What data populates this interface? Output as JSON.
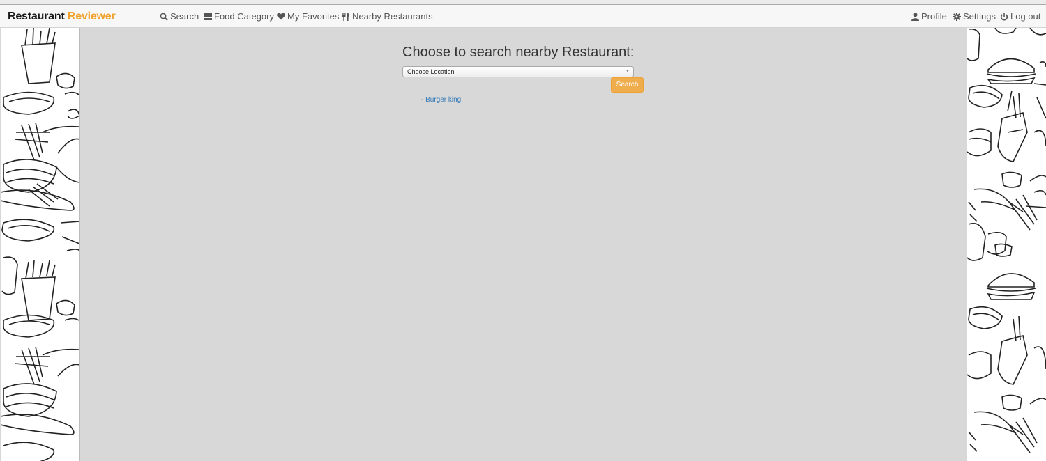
{
  "brand": {
    "name_part1": "Restaurant",
    "name_part2": "Reviewer"
  },
  "nav_left": [
    {
      "label": "Search",
      "icon": "search-icon"
    },
    {
      "label": "Food Category",
      "icon": "list-icon"
    },
    {
      "label": "My Favorites",
      "icon": "heart-icon"
    },
    {
      "label": "Nearby Restaurants",
      "icon": "cutlery-icon"
    }
  ],
  "nav_right": [
    {
      "label": "Profile",
      "icon": "user-icon"
    },
    {
      "label": "Settings",
      "icon": "gear-icon"
    },
    {
      "label": "Log out",
      "icon": "power-icon"
    }
  ],
  "main": {
    "title": "Choose to search nearby Restaurant:",
    "location_select": {
      "selected": "Choose Location"
    },
    "search_button": "Search",
    "results": [
      "- Burger king"
    ]
  },
  "colors": {
    "accent": "#f0a22a",
    "button": "#f0ad4e",
    "link": "#337ab7",
    "background": "#d8d8d8"
  }
}
